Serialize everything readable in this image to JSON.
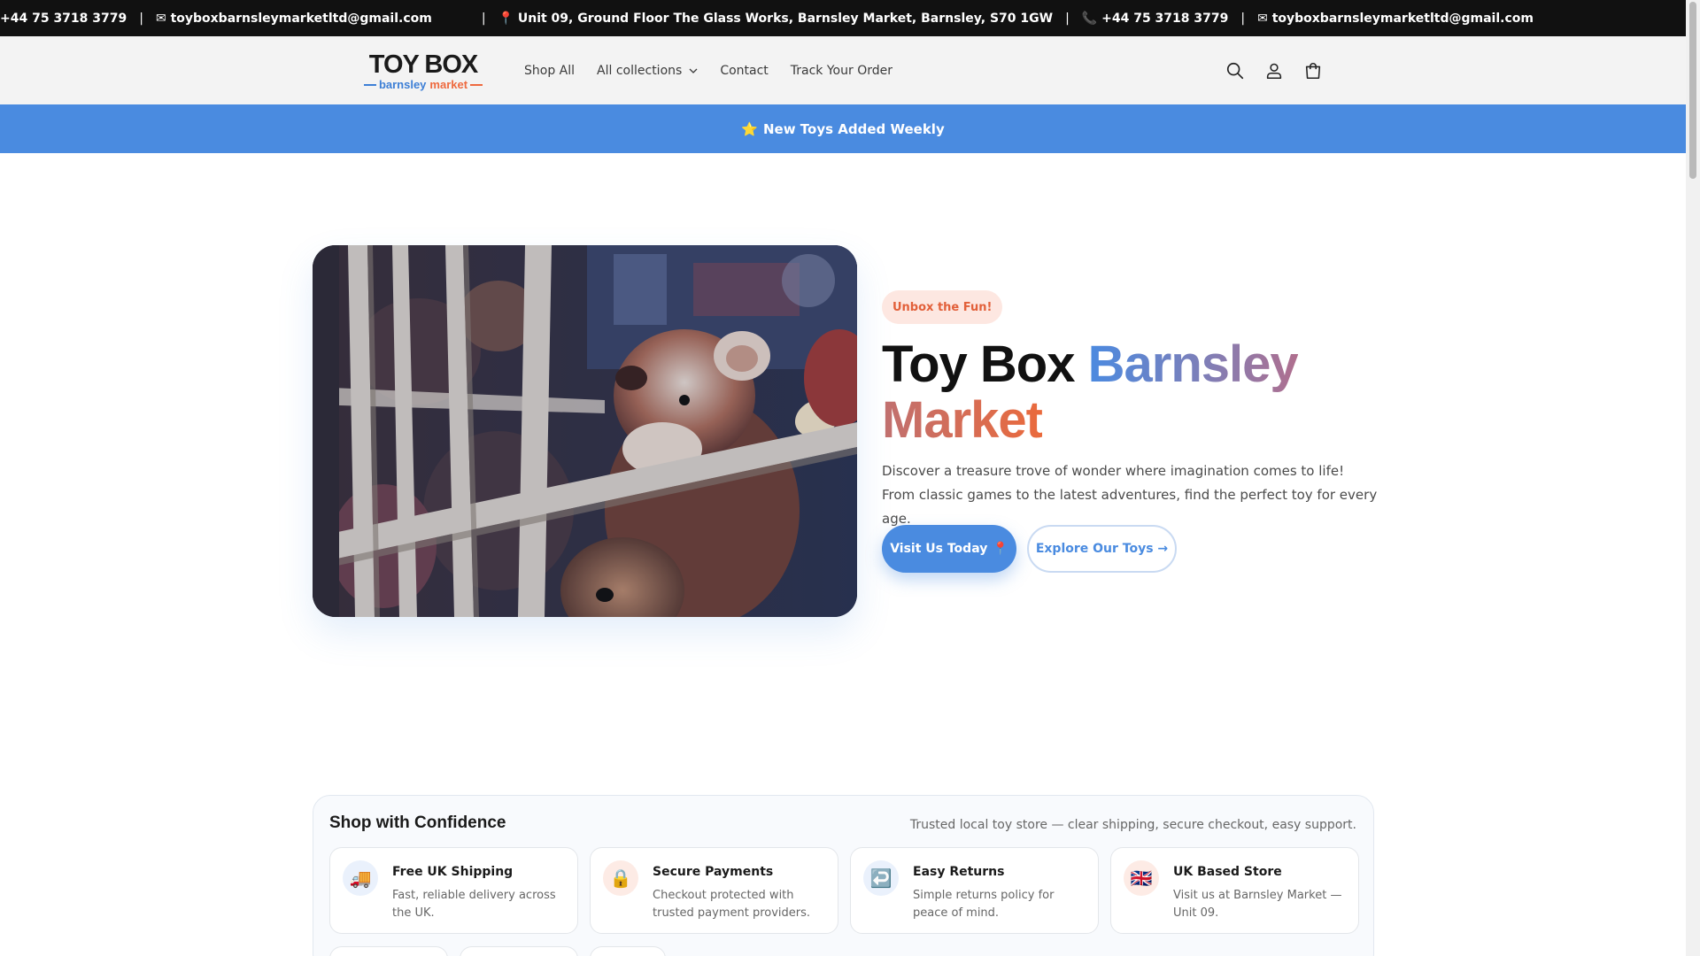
{
  "topbar": {
    "items": [
      "+44 75 3718 3779",
      "✉ toyboxbarnsleymarketltd@gmail.com",
      "📍 Unit 09, Ground Floor The Glass Works, Barnsley Market, Barnsley, S70 1GW",
      "📞 +44 75 3718 3779",
      "✉ toyboxbarnsleymarketltd@gmail.com"
    ],
    "separator": "|"
  },
  "logo": {
    "main": "TOY BOX",
    "sub_word1": "barnsley",
    "sub_word2": "market"
  },
  "nav": {
    "shop_all": "Shop All",
    "all_collections": "All collections",
    "contact": "Contact",
    "track_order": "Track Your Order"
  },
  "header_icons": [
    "search-icon",
    "account-icon",
    "cart-icon"
  ],
  "promo": {
    "star": "⭐",
    "text": "New Toys Added Weekly"
  },
  "hero": {
    "badge": "Unbox the Fun!",
    "title_part1": "Toy Box ",
    "title_part2": "Barnsley",
    "title_part3": "Market",
    "description": "Discover a treasure trove of wonder where imagination comes to life! From classic games to the latest adventures, find the perfect toy for every age.",
    "primary_button": "Visit Us Today",
    "primary_button_icon": "📍",
    "secondary_button": "Explore Our Toys →"
  },
  "confidence": {
    "title": "Shop with Confidence",
    "subtitle": "Trusted local toy store — clear shipping, secure checkout, easy support.",
    "cards": [
      {
        "icon": "🚚",
        "title": "Free UK Shipping",
        "text": "Fast, reliable delivery across the UK.",
        "tint": "#eaf1fc"
      },
      {
        "icon": "🔒",
        "title": "Secure Payments",
        "text": "Checkout protected with trusted payment providers.",
        "tint": "#fdebe5"
      },
      {
        "icon": "↩️",
        "title": "Easy Returns",
        "text": "Simple returns policy for peace of mind.",
        "tint": "#eaf1fc"
      },
      {
        "icon": "🇬🇧",
        "title": "UK Based Store",
        "text": "Visit us at Barnsley Market — Unit 09.",
        "tint": "#fdebe5"
      }
    ]
  },
  "colors": {
    "accent_blue": "#4a8be0",
    "accent_orange": "#ea6a3c",
    "topbar_bg": "#111111",
    "header_bg": "#f3f3f3"
  }
}
